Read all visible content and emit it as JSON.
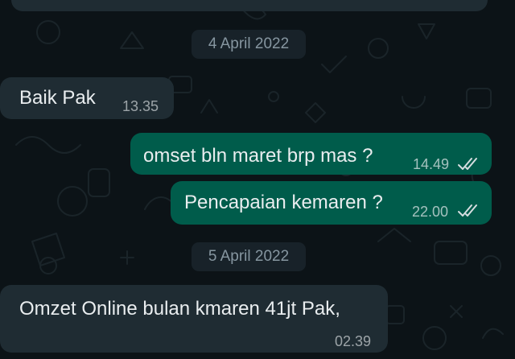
{
  "conversation": {
    "dates": [
      "4 April 2022",
      "5 April 2022"
    ],
    "messages": [
      {
        "direction": "incoming",
        "text": "Baik Pak",
        "time": "13.35"
      },
      {
        "direction": "outgoing",
        "text": "omset bln maret brp mas ?",
        "time": "14.49",
        "status": "read"
      },
      {
        "direction": "outgoing",
        "text": "Pencapaian kemaren ?",
        "time": "22.00",
        "status": "read"
      },
      {
        "direction": "incoming",
        "text": "Omzet Online bulan kmaren 41jt Pak,",
        "time": "02.39"
      }
    ]
  },
  "colors": {
    "background": "#0c1317",
    "incoming_bubble": "#1f2c33",
    "outgoing_bubble": "#005c4b",
    "date_chip": "#182229",
    "tick_color": "#d6dde0"
  },
  "icons": {
    "read_receipt": "double-check-icon",
    "wallpaper": "doodle-pattern"
  }
}
